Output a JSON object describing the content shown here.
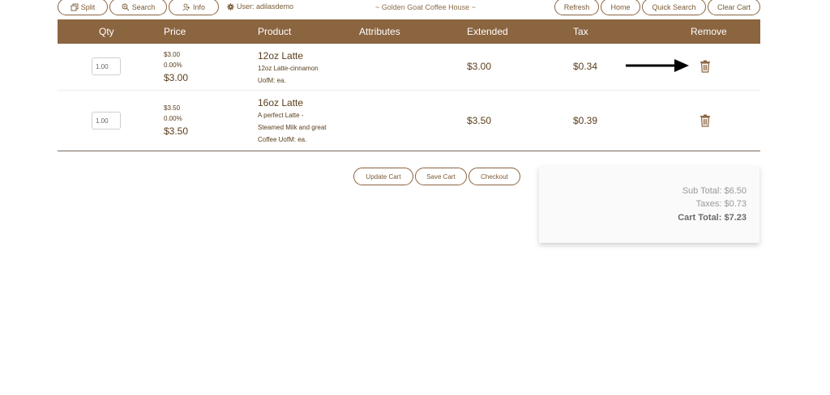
{
  "topbar": {
    "split_label": "Split",
    "search_label": "Search",
    "info_label": "Info",
    "user_label": "User: adilasdemo",
    "store_name": "~ Golden Goat Coffee House ~",
    "refresh_label": "Refresh",
    "home_label": "Home",
    "quick_search_label": "Quick Search",
    "clear_cart_label": "Clear Cart"
  },
  "table": {
    "columns": [
      "Qty",
      "Price",
      "Product",
      "Attributes",
      "Extended",
      "Tax",
      "Remove"
    ],
    "rows": [
      {
        "qty": "1.00",
        "unit_price": "$3.00",
        "discount": "0.00%",
        "price": "$3.00",
        "product_name": "12oz Latte",
        "description_lines": [
          "12oz Latte-cinnamon",
          "UofM: ea."
        ],
        "extended": "$3.00",
        "tax": "$0.34"
      },
      {
        "qty": "1.00",
        "unit_price": "$3.50",
        "discount": "0.00%",
        "price": "$3.50",
        "product_name": "16oz Latte",
        "description_lines": [
          "A perfect Latte -",
          "Steamed Milk and great",
          "Coffee UofM: ea."
        ],
        "extended": "$3.50",
        "tax": "$0.39"
      }
    ]
  },
  "actions": {
    "update_cart_label": "Update Cart",
    "save_cart_label": "Save Cart",
    "checkout_label": "Checkout"
  },
  "totals": {
    "sub_total": "Sub Total: $6.50",
    "taxes": "Taxes: $0.73",
    "cart_total": "Cart Total: $7.23"
  },
  "colors": {
    "header_brown": "#8b6440",
    "text_brown": "#5a3e1b"
  },
  "icons": [
    "copy-icon",
    "zoom-icon",
    "add-user-icon",
    "gear-icon",
    "trash-icon",
    "arrow-icon"
  ]
}
